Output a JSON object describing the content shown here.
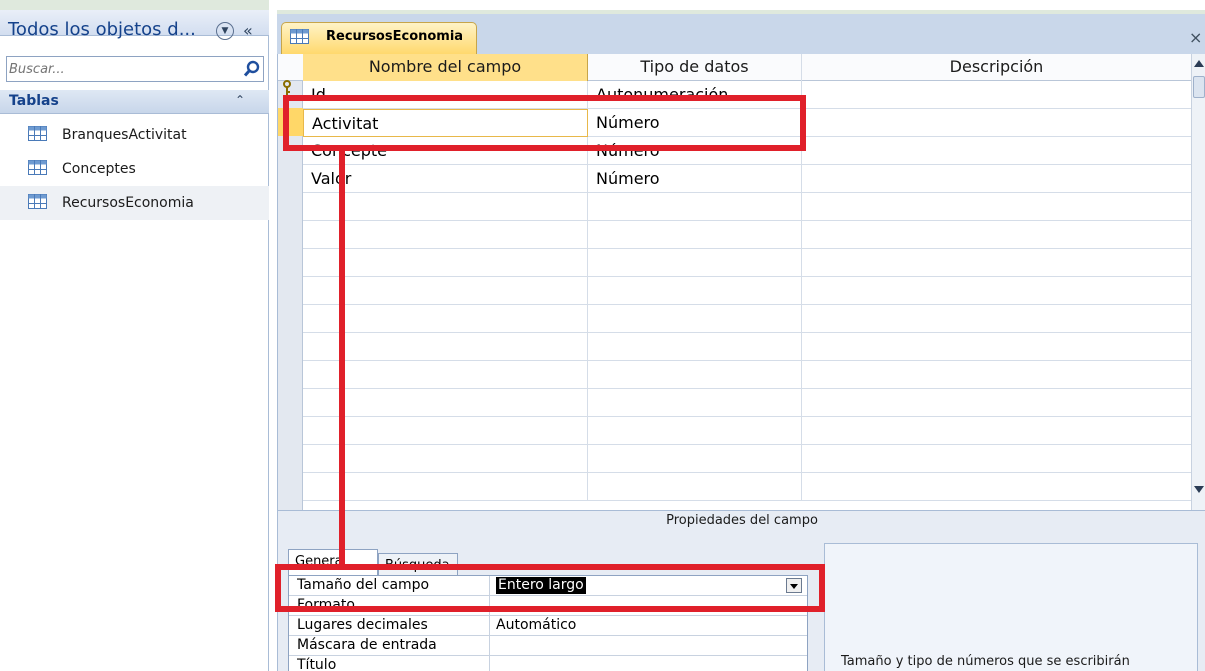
{
  "nav": {
    "title": "Todos los objetos d...",
    "search": {
      "placeholder": "Buscar..."
    },
    "group": "Tablas",
    "items": [
      {
        "label": "BranquesActivitat",
        "selected": false
      },
      {
        "label": "Conceptes",
        "selected": false
      },
      {
        "label": "RecursosEconomia",
        "selected": true
      }
    ]
  },
  "document": {
    "tab_label": "RecursosEconomia"
  },
  "grid": {
    "columns": [
      "Nombre del campo",
      "Tipo de datos",
      "Descripción"
    ],
    "rows": [
      {
        "name": "Id",
        "type": "Autonumeración",
        "primary_key": true
      },
      {
        "name": "Activitat",
        "type": "Número",
        "current": true
      },
      {
        "name": "Concepte",
        "type": "Número"
      },
      {
        "name": "Valor",
        "type": "Número"
      }
    ]
  },
  "properties": {
    "title": "Propiedades del campo",
    "tabs": [
      "General",
      "Búsqueda"
    ],
    "rows": [
      {
        "name": "Tamaño del campo",
        "value": "Entero largo"
      },
      {
        "name": "Formato",
        "value": ""
      },
      {
        "name": "Lugares decimales",
        "value": "Automático"
      },
      {
        "name": "Máscara de entrada",
        "value": ""
      },
      {
        "name": "Título",
        "value": ""
      }
    ],
    "help": "Tamaño y tipo de números que se escribirán"
  },
  "colors": {
    "annotation_red": "#e0202a",
    "selected_header": "#ffe08a",
    "nav_title": "#15428b"
  },
  "icons": [
    "table-icon",
    "search-icon",
    "primary-key-icon",
    "close-icon",
    "dropdown-arrow-icon"
  ]
}
